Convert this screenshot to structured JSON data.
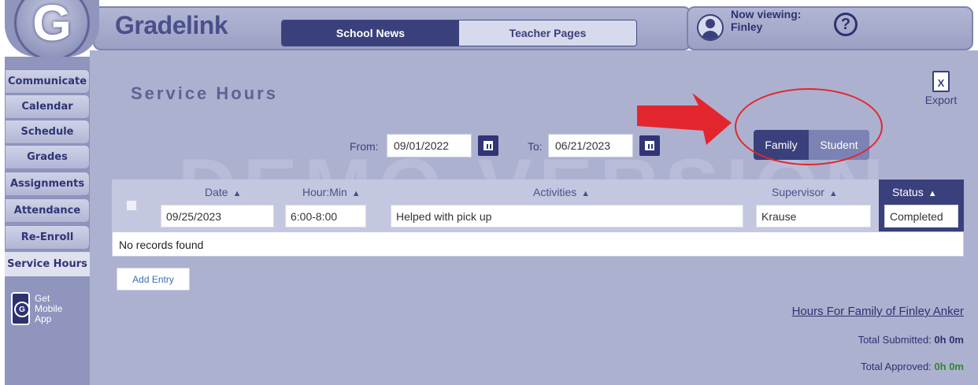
{
  "header": {
    "logo_letter": "G",
    "brand": "Gradelink",
    "tabs": [
      {
        "label": "School News",
        "active": true
      },
      {
        "label": "Teacher Pages",
        "active": false
      }
    ],
    "now_viewing_label": "Now viewing:",
    "now_viewing_name": "Finley",
    "help_glyph": "?"
  },
  "sidebar": {
    "items": [
      {
        "label": "Communicate",
        "active": false
      },
      {
        "label": "Calendar",
        "active": false
      },
      {
        "label": "Schedule",
        "active": false
      },
      {
        "label": "Grades",
        "active": false
      },
      {
        "label": "Assignments",
        "active": false
      },
      {
        "label": "Attendance",
        "active": false
      },
      {
        "label": "Re-Enroll",
        "active": false
      },
      {
        "label": "Service Hours",
        "active": true
      }
    ],
    "mobile_app": {
      "line1": "Get",
      "line2": "Mobile",
      "line3": "App"
    }
  },
  "main": {
    "watermark": "DEMO VERSION",
    "title": "Service Hours",
    "export_label": "Export",
    "export_icon_glyph": "X",
    "from_label": "From:",
    "from_date": "09/01/2022",
    "to_label": "To:",
    "to_date": "06/21/2023",
    "toggle": {
      "family": "Family",
      "student": "Student",
      "selected": "Family"
    },
    "table": {
      "columns": [
        {
          "label": "Date",
          "sort": "both"
        },
        {
          "label": "Hour:Min",
          "sort": "both"
        },
        {
          "label": "Activities",
          "sort": "both"
        },
        {
          "label": "Supervisor",
          "sort": "both"
        },
        {
          "label": "Status",
          "sort": "asc"
        }
      ],
      "filters": {
        "date": "09/25/2023",
        "hour_min": "6:00-8:00",
        "activities": "Helped with pick up",
        "supervisor": "Krause",
        "status": "Completed"
      },
      "empty_message": "No records found"
    },
    "add_entry_label": "Add Entry",
    "hours_title": "Hours For Family of Finley Anker",
    "total_submitted_label": "Total Submitted:",
    "total_submitted_value": "0h 0m",
    "total_approved_label": "Total Approved:",
    "total_approved_value": "0h 0m"
  },
  "colors": {
    "accent_dark": "#3a407c",
    "panel": "#adb1d0",
    "annotation_red": "#e3262e",
    "approved_green": "#2d8a2d"
  }
}
